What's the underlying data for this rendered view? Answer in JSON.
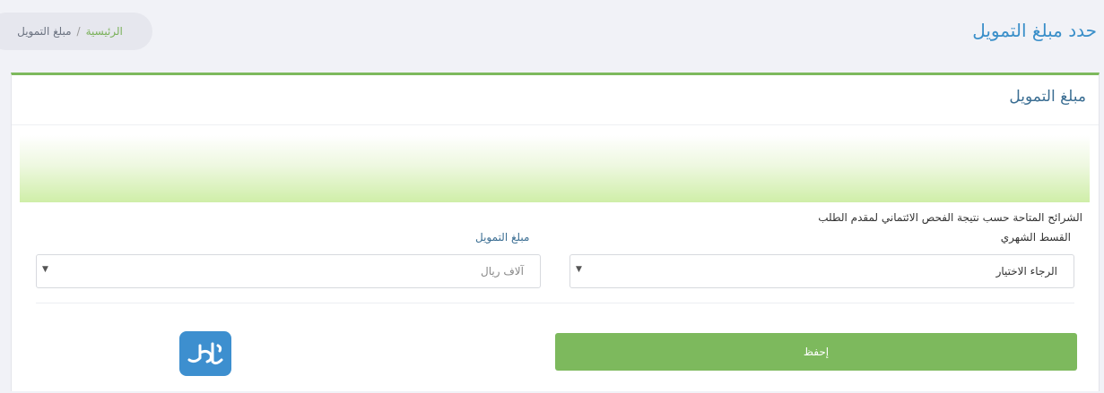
{
  "header": {
    "page_title": "حدد مبلغ التمويل",
    "breadcrumb": {
      "home": "الرئيسية",
      "separator": "/",
      "current": "مبلغ التمويل"
    }
  },
  "card": {
    "title": "مبلغ التمويل",
    "helper_text": "الشرائح المتاحة حسب نتيجة الفحص الائتماني لمقدم الطلب",
    "monthly_label": "القسط الشهري",
    "monthly_select": {
      "value": "الرجاء الاختيار"
    },
    "amount_label": "مبلغ التمويل",
    "amount_select": {
      "value": "آلاف ريال"
    },
    "save_label": "إحفظ"
  },
  "logo": {
    "text": "المرجع"
  },
  "colors": {
    "accent_green": "#7db95d",
    "title_blue": "#3a8fc9",
    "logo_blue": "#3d8fcf"
  }
}
